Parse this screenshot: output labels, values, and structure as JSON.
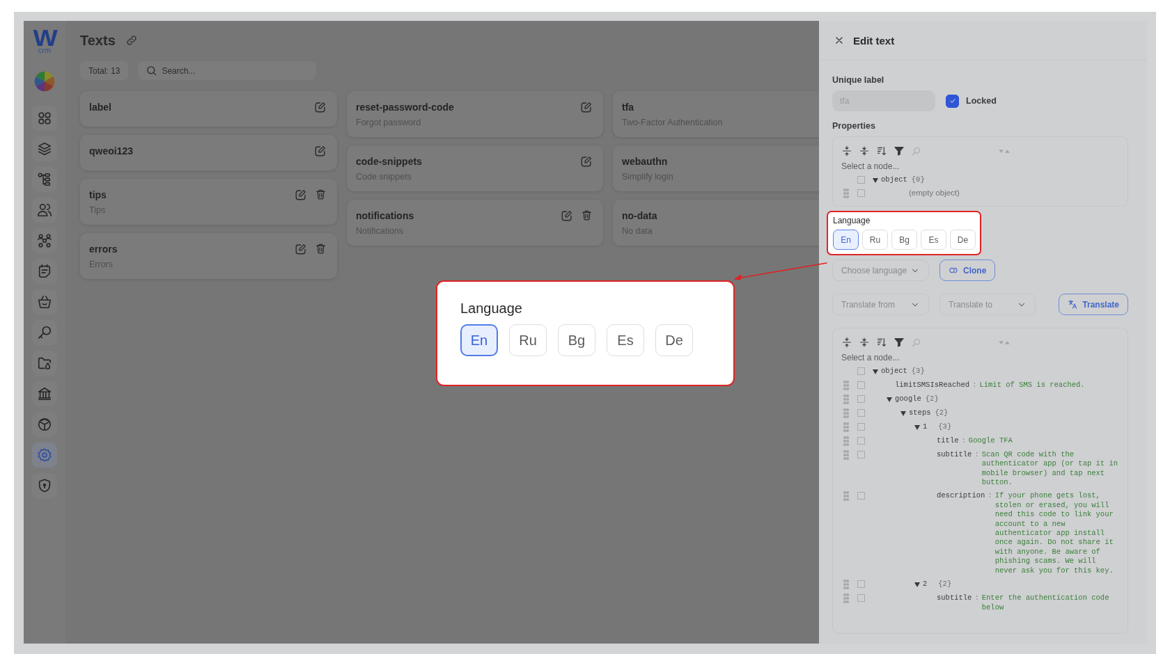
{
  "sidebar": {
    "logo": {
      "mark": "W",
      "caption": "crm"
    },
    "items": [
      {
        "kind": "grid",
        "selected": false
      },
      {
        "kind": "layers",
        "selected": false
      },
      {
        "kind": "hierarchy",
        "selected": false
      },
      {
        "kind": "users",
        "selected": false
      },
      {
        "kind": "groups",
        "selected": false
      },
      {
        "kind": "note",
        "selected": false
      },
      {
        "kind": "basket",
        "selected": false
      },
      {
        "kind": "key",
        "selected": false
      },
      {
        "kind": "folder",
        "selected": false
      },
      {
        "kind": "bank",
        "selected": false
      },
      {
        "kind": "cube",
        "selected": false
      },
      {
        "kind": "gear",
        "selected": true
      },
      {
        "kind": "shield",
        "selected": false
      }
    ]
  },
  "page": {
    "title": "Texts",
    "total": "Total: 13",
    "search": {
      "placeholder": "Search..."
    }
  },
  "card_columns": [
    [
      {
        "name": "label",
        "editable": true,
        "deletable": false
      },
      {
        "name": "qweoi123",
        "editable": true,
        "deletable": false
      },
      {
        "name": "tips",
        "subtitle": "Tips",
        "editable": true,
        "deletable": true
      },
      {
        "name": "errors",
        "subtitle": "Errors",
        "editable": true,
        "deletable": true
      }
    ],
    [
      {
        "name": "reset-password-code",
        "subtitle": "Forgot password",
        "editable": true,
        "deletable": false
      },
      {
        "name": "code-snippets",
        "subtitle": "Code snippets",
        "editable": true,
        "deletable": false
      },
      {
        "name": "notifications",
        "subtitle": "Notifications",
        "editable": true,
        "deletable": true
      }
    ],
    [
      {
        "name": "tfa",
        "subtitle": "Two-Factor Authentication"
      },
      {
        "name": "webauthn",
        "subtitle": "Simplify login"
      },
      {
        "name": "no-data",
        "subtitle": "No data"
      }
    ]
  ],
  "panel": {
    "title": "Edit text",
    "unique_label": {
      "label": "Unique label",
      "value": "tfa",
      "disabled": true
    },
    "locked": {
      "label": "Locked",
      "checked": true
    },
    "properties": {
      "label": "Properties",
      "placeholder": "Select a node...",
      "tree": [
        {
          "key": "object",
          "count": "{0}",
          "expanded": true,
          "checked": false,
          "children": [
            {
              "note": "(empty object)",
              "checked": false
            }
          ]
        }
      ]
    },
    "language": {
      "label": "Language",
      "options": [
        {
          "label": "En",
          "selected": true
        },
        {
          "label": "Ru",
          "selected": false
        },
        {
          "label": "Bg",
          "selected": false
        },
        {
          "label": "Es",
          "selected": false
        },
        {
          "label": "De",
          "selected": false
        }
      ]
    },
    "choose_language": {
      "placeholder": "Choose language"
    },
    "clone": "Clone",
    "translate_from": {
      "placeholder": "Translate from"
    },
    "translate_to": {
      "placeholder": "Translate to"
    },
    "translate": "Translate",
    "content": {
      "placeholder": "Select a node...",
      "separator": ":",
      "tree": [
        {
          "key": "object",
          "count": "{3}",
          "expanded": true,
          "checked": false,
          "children": [
            {
              "key": "limitSMSIsReached",
              "value": "Limit of SMS is reached.",
              "checked": false
            },
            {
              "key": "google",
              "count": "{2}",
              "expanded": true,
              "checked": false,
              "children": [
                {
                  "key": "steps",
                  "count": "{2}",
                  "expanded": true,
                  "checked": false,
                  "children": [
                    {
                      "key": "1",
                      "count": "{3}",
                      "expanded": true,
                      "checked": false,
                      "children": [
                        {
                          "key": "title",
                          "value": "Google TFA",
                          "checked": false
                        },
                        {
                          "key": "subtitle",
                          "value": "Scan QR code with the authenticator app (or tap it in mobile browser) and tap next button.",
                          "checked": false
                        },
                        {
                          "key": "description",
                          "value": "If your phone gets lost, stolen or erased, you will need this code to link your account to a new authenticator app install once again. Do not share it with anyone. Be aware of phishing scams. We will never ask you for this key.",
                          "checked": false
                        }
                      ]
                    },
                    {
                      "key": "2",
                      "count": "{2}",
                      "expanded": true,
                      "checked": false,
                      "children": [
                        {
                          "key": "subtitle",
                          "value": "Enter the authentication code below",
                          "checked": false
                        }
                      ]
                    }
                  ]
                }
              ]
            }
          ]
        }
      ]
    }
  },
  "callout": {
    "label": "Language",
    "options": [
      {
        "label": "En",
        "selected": true
      },
      {
        "label": "Ru",
        "selected": false
      },
      {
        "label": "Bg",
        "selected": false
      },
      {
        "label": "Es",
        "selected": false
      },
      {
        "label": "De",
        "selected": false
      }
    ]
  }
}
